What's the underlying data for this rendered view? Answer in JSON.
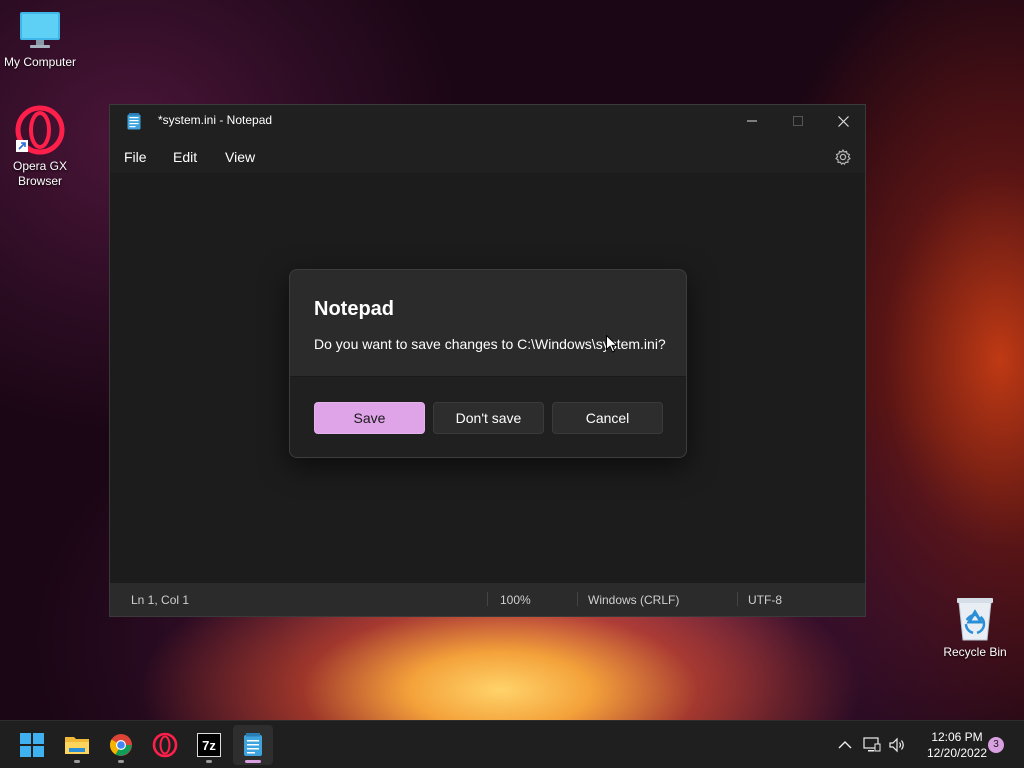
{
  "desktop": {
    "icons": [
      {
        "label": "My Computer"
      },
      {
        "label": "Opera GX Browser"
      },
      {
        "label": "Recycle Bin"
      }
    ]
  },
  "notepad": {
    "title": "*system.ini - Notepad",
    "menu": [
      "File",
      "Edit",
      "View"
    ],
    "status": {
      "position": "Ln 1, Col 1",
      "zoom": "100%",
      "line_ending": "Windows (CRLF)",
      "encoding": "UTF-8"
    }
  },
  "dialog": {
    "title": "Notepad",
    "message": "Do you want to save changes to C:\\Windows\\system.ini?",
    "buttons": {
      "save": "Save",
      "dont_save": "Don't save",
      "cancel": "Cancel"
    }
  },
  "taskbar": {
    "apps": [
      "start-icon",
      "file-explorer-icon",
      "chrome-icon",
      "opera-gx-icon",
      "7zip-icon",
      "notepad-icon"
    ],
    "active_app": "notepad-icon",
    "clock": {
      "time": "12:06 PM",
      "date": "12/20/2022"
    },
    "notifications": "3",
    "sevenzip_label": "7z"
  },
  "colors": {
    "accent": "#dfa3e8",
    "window_bg": "#202020",
    "dialog_bg": "#2b2b2b"
  }
}
